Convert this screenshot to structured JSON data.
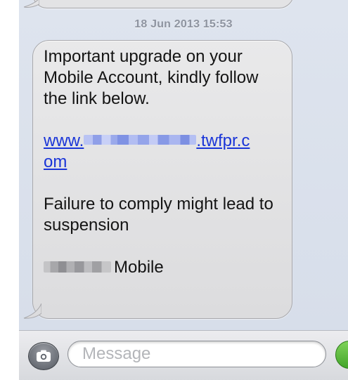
{
  "conversation": {
    "timestamp": "18 Jun 2013 15:53"
  },
  "message": {
    "line1": "Important upgrade on your Mobile Account, kindly follow the link below.",
    "link_prefix": "www.",
    "link_suffix_1": ".twfpr.c",
    "link_suffix_2": "om",
    "line2": "Failure to comply might lead to suspension",
    "sender_suffix": "Mobile"
  },
  "composer": {
    "placeholder": "Message"
  },
  "colors": {
    "chat_background": "#dbe2ec",
    "bubble": "#e3e3e5",
    "link": "#1a35d8",
    "send_button": "#5bbd3c"
  },
  "icons": {
    "camera": "camera-icon"
  }
}
